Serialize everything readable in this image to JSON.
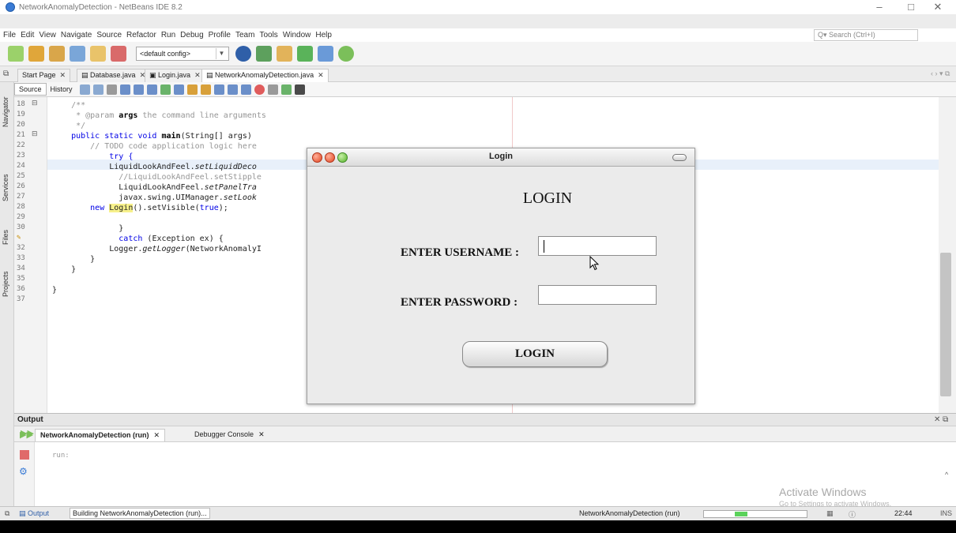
{
  "window": {
    "title": "NetworkAnomalyDetection - NetBeans IDE 8.2",
    "minimize": "–",
    "maximize": "□",
    "close": "✕"
  },
  "menu": [
    "File",
    "Edit",
    "View",
    "Navigate",
    "Source",
    "Refactor",
    "Run",
    "Debug",
    "Profile",
    "Team",
    "Tools",
    "Window",
    "Help"
  ],
  "search": {
    "placeholder": "Search (Ctrl+I)"
  },
  "toolbar": {
    "config": "<default config>"
  },
  "tabs": [
    {
      "label": "Start Page"
    },
    {
      "label": "Database.java"
    },
    {
      "label": "Login.java"
    },
    {
      "label": "NetworkAnomalyDetection.java"
    }
  ],
  "source_tabs": {
    "source": "Source",
    "history": "History"
  },
  "side_tabs": [
    "Navigator",
    "Services",
    "Files",
    "Projects"
  ],
  "code_lines": {
    "n18": "18",
    "n19": "19",
    "n20": "20",
    "n21": "21",
    "n22": "22",
    "n23": "23",
    "n24": "24",
    "n25": "25",
    "n26": "26",
    "n27": "27",
    "n28": "28",
    "n29": "29",
    "n30": "30",
    "n31": "31",
    "n32": "32",
    "n33": "33",
    "n34": "34",
    "n35": "35",
    "n36": "36",
    "n37": "37",
    "l18": "    /**",
    "l19a": "     * @param ",
    "l19b": "args",
    "l19c": " the command line arguments",
    "l20": "     */",
    "l21a": "    public static void ",
    "l21b": "main",
    "l21c": "(String[] args)",
    "l22": "        // TODO code application logic here",
    "l23": "            try {",
    "l24a": "            LiquidLookAndFeel.",
    "l24b": "setLiquidDeco",
    "l25": "              //LiquidLookAndFeel.setStipple",
    "l26a": "              LiquidLookAndFeel.",
    "l26b": "setPanelTra",
    "l27a": "              javax.swing.UIManager.",
    "l27b": "setLook",
    "l28a": "        new ",
    "l28b": "Login",
    "l28c": "().setVisible(",
    "l28d": "true",
    "l28e": ");",
    "l30": "              }",
    "l31a": "              catch ",
    "l31b": "(Exception ex) {",
    "l32a": "            Logger.",
    "l32b": "getLogger",
    "l32c": "(NetworkAnomalyI",
    "l33": "        }",
    "l34": "    }",
    "l36": "}"
  },
  "output": {
    "title": "Output",
    "tab_run": "NetworkAnomalyDetection (run)",
    "tab_debug": "Debugger Console",
    "text": "run:",
    "watermark_title": "Activate Windows",
    "watermark_sub": "Go to Settings to activate Windows."
  },
  "status": {
    "output_tab": "Output",
    "building": "Building NetworkAnomalyDetection (run)...",
    "project": "NetworkAnomalyDetection (run)",
    "time": "22:44",
    "ins": "INS",
    "progress": 0.12
  },
  "login": {
    "window_title": "Login",
    "heading": "LOGIN",
    "username_label": "ENTER USERNAME :",
    "password_label": "ENTER PASSWORD :",
    "button": "LOGIN"
  }
}
